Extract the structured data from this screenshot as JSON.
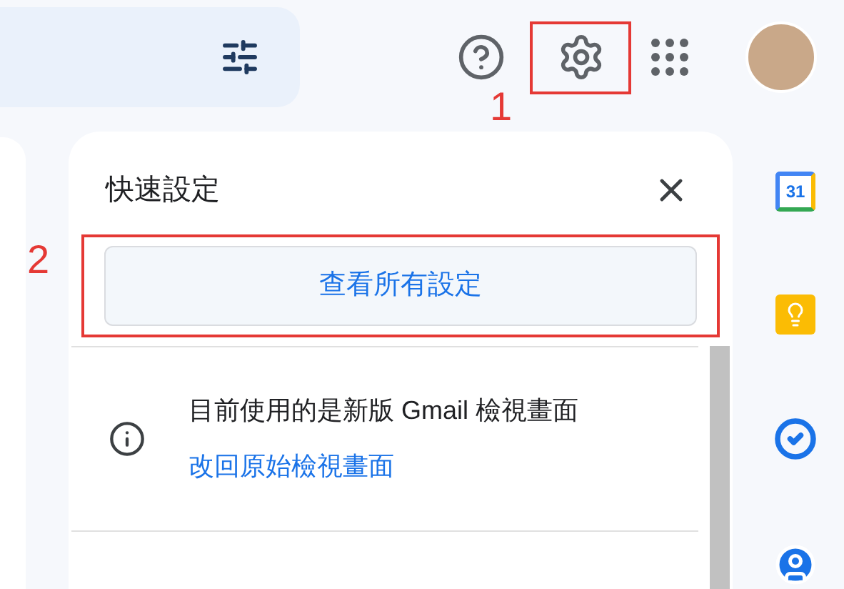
{
  "header": {
    "settings_annotation": "1"
  },
  "quick_settings": {
    "title": "快速設定",
    "see_all_button": "查看所有設定",
    "see_all_annotation": "2",
    "notice": {
      "text": "目前使用的是新版 Gmail 檢視畫面",
      "link": "改回原始檢視畫面"
    }
  },
  "side_apps": [
    {
      "kind": "calendar",
      "label": "31"
    },
    {
      "kind": "keep"
    },
    {
      "kind": "tasks"
    },
    {
      "kind": "contacts"
    }
  ]
}
